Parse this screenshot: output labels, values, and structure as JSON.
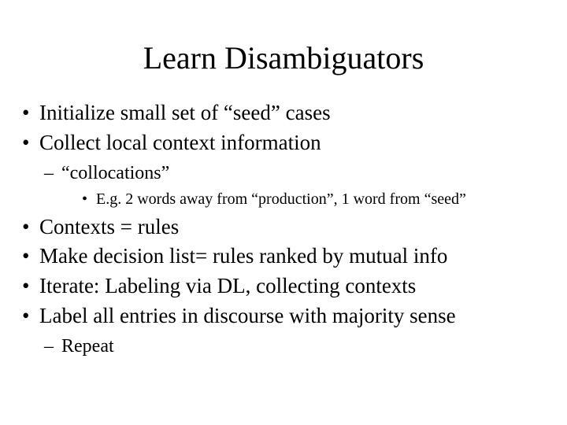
{
  "title": "Learn Disambiguators",
  "bullets": {
    "b1": "Initialize small set of “seed” cases",
    "b2": "Collect local context information",
    "b2_sub1": "“collocations”",
    "b2_sub1_sub1": "E.g. 2 words away from “production”, 1 word from “seed”",
    "b3": "Contexts = rules",
    "b4": "Make decision list= rules ranked by mutual info",
    "b5": "Iterate: Labeling via DL, collecting contexts",
    "b6": "Label all entries in discourse with majority sense",
    "b6_sub1": "Repeat"
  }
}
